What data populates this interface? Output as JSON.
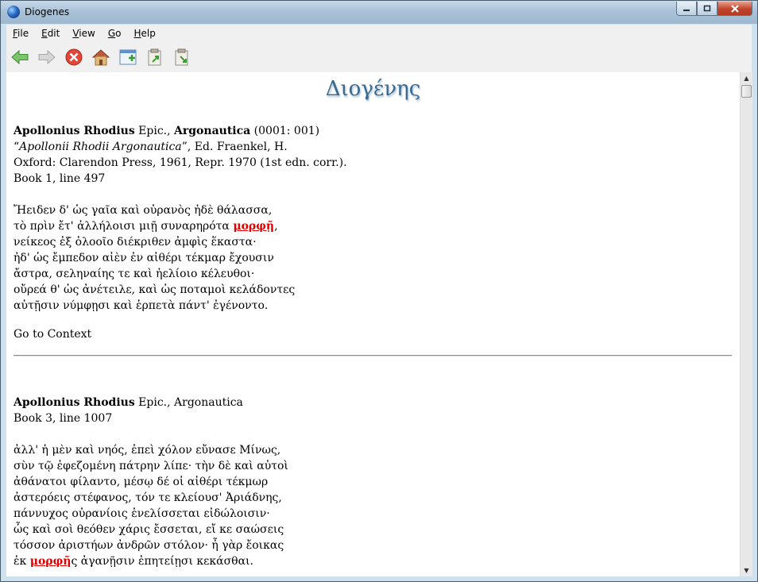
{
  "window": {
    "title": "Diogenes"
  },
  "menu": [
    "File",
    "Edit",
    "View",
    "Go",
    "Help"
  ],
  "menu_underline": [
    "F",
    "E",
    "V",
    "G",
    "H"
  ],
  "toolbar": [
    "back-icon",
    "forward-icon",
    "stop-icon",
    "home-icon",
    "new-search-icon",
    "export-icon",
    "import-icon"
  ],
  "content": {
    "logo": "Διογένης",
    "result1": {
      "author": "Apollonius Rhodius",
      "genre": " Epic., ",
      "work": "Argonautica",
      "code": " (0001: 001)",
      "edition_open": "“",
      "edition_title": "Apollonii Rhodii Argonautica",
      "edition_rest": "”, Ed. Fraenkel, H.",
      "publisher": "Oxford: Clarendon Press, 1961, Repr. 1970 (1st edn. corr.).",
      "location": "Book 1, line 497",
      "lines": [
        "Ἤειδεν δ' ὡς γαῖα καὶ οὐρανὸς ἠδὲ θάλασσα,",
        "τὸ πρὶν ἔτ' ἀλλήλοισι μιῇ συναρηρότα ",
        "νείκεος ἐξ ὀλοοῖο διέκριθεν ἀμφὶς ἕκαστα·",
        "ἠδ' ὡς ἔμπεδον αἰὲν ἐν αἰθέρι τέκμαρ ἔχουσιν",
        "ἄστρα, σεληναίης τε καὶ ἠελίοιο κέλευθοι·",
        "οὔρεά θ' ὡς ἀνέτειλε, καὶ ὡς ποταμοὶ κελάδοντες",
        "αὐτῇσιν νύμφῃσι καὶ ἑρπετὰ πάντ' ἐγένοντο."
      ],
      "hit": "μορφῇ",
      "hit_after": ",",
      "context_link": "Go to Context"
    },
    "result2": {
      "author": "Apollonius Rhodius",
      "genre_work": " Epic., Argonautica",
      "location": "Book 3, line 1007",
      "lines": [
        "ἀλλ' ἡ μὲν καὶ νηός, ἐπεὶ χόλον εὔνασε Μίνως,",
        "σὺν τῷ ἐφεζομένη πάτρην λίπε· τὴν δὲ καὶ αὐτοὶ",
        "ἀθάνατοι φίλαντο, μέσῳ δέ οἱ αἰθέρι τέκμωρ",
        "ἀστερόεις στέφανος, τόν τε κλείουσ' Ἀριάδνης,",
        "πάννυχος οὐρανίοις ἑνελίσσεται εἰδώλοισιν·",
        "ὧς καὶ σοὶ θεόθεν χάρις ἔσσεται, εἴ κε σαώσεις",
        "τόσσον ἀριστήων ἀνδρῶν στόλον· ἦ γὰρ ἔοικας"
      ],
      "last_before": "ἐκ ",
      "hit": "μορφῆ",
      "last_after": "ς ἀγανῇσιν ἐπητείῃσι κεκάσθαι."
    }
  }
}
